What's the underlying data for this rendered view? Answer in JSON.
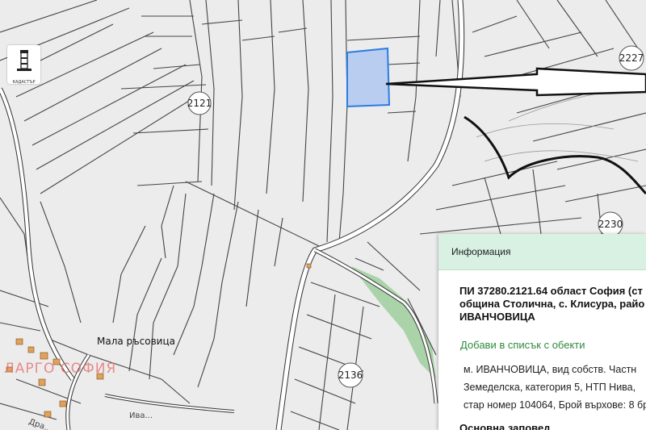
{
  "map": {
    "parcel_labels": [
      "2121",
      "2227",
      "2230",
      "2136"
    ],
    "place_name": "Мала ръсовица",
    "watermark": "ЛАРГО СОФИЯ",
    "street_labels": [
      "Дра...",
      "Ива..."
    ],
    "selected_parcel_color": "#b8cdf0",
    "selected_parcel_border": "#2a7de1",
    "road_color": "#ffffff",
    "highlight_green": "#8fc98f"
  },
  "logo": {
    "icon": "lighthouse-logo-icon",
    "caption": "КАДАСТЪР"
  },
  "info_panel": {
    "header": "Информация",
    "title_lines": [
      "ПИ 37280.2121.64 област София (ст",
      "община Столична, с. Клисура, райо",
      "ИВАНЧОВИЦА"
    ],
    "add_link": "Добави в списък с обекти",
    "details": [
      "м. ИВАНЧОВИЦА, вид собств. Частн",
      "Земеделска, категория 5, НТП Нива,",
      "стар номер 104064, Брой върхове: 8 бр"
    ],
    "section_title": "Основна заповед"
  }
}
